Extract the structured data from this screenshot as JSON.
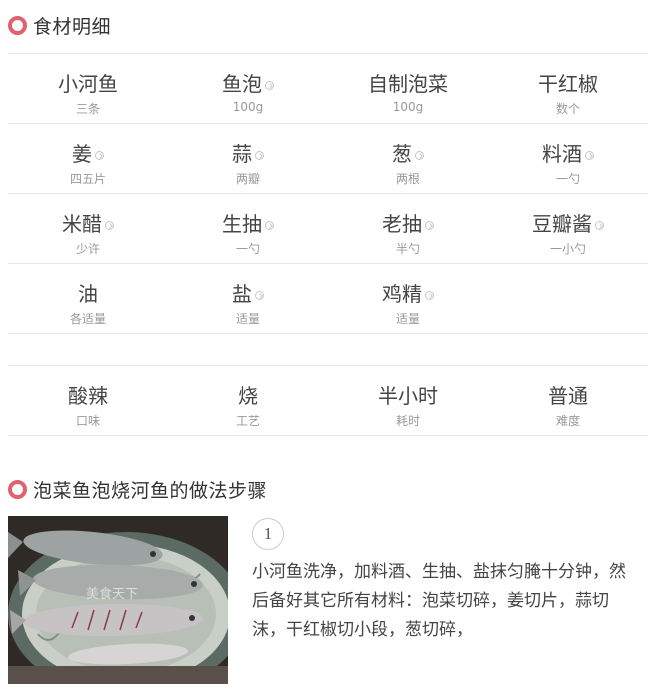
{
  "ingredients_section": {
    "title": "食材明细"
  },
  "ingredients": [
    [
      {
        "name": "小河鱼",
        "amount": "三条",
        "link": false
      },
      {
        "name": "鱼泡",
        "amount": "100g",
        "link": true
      },
      {
        "name": "自制泡菜",
        "amount": "100g",
        "link": false
      },
      {
        "name": "干红椒",
        "amount": "数个",
        "link": false
      }
    ],
    [
      {
        "name": "姜",
        "amount": "四五片",
        "link": true
      },
      {
        "name": "蒜",
        "amount": "两瓣",
        "link": true
      },
      {
        "name": "葱",
        "amount": "两根",
        "link": true
      },
      {
        "name": "料酒",
        "amount": "一勺",
        "link": true
      }
    ],
    [
      {
        "name": "米醋",
        "amount": "少许",
        "link": true
      },
      {
        "name": "生抽",
        "amount": "一勺",
        "link": true
      },
      {
        "name": "老抽",
        "amount": "半勺",
        "link": true
      },
      {
        "name": "豆瓣酱",
        "amount": "一小勺",
        "link": true
      }
    ],
    [
      {
        "name": "油",
        "amount": "各适量",
        "link": false
      },
      {
        "name": "盐",
        "amount": "适量",
        "link": true
      },
      {
        "name": "鸡精",
        "amount": "适量",
        "link": true
      }
    ]
  ],
  "meta": [
    {
      "value": "酸辣",
      "label": "口味"
    },
    {
      "value": "烧",
      "label": "工艺"
    },
    {
      "value": "半小时",
      "label": "耗时"
    },
    {
      "value": "普通",
      "label": "难度"
    }
  ],
  "steps_section": {
    "title": "泡菜鱼泡烧河鱼的做法步骤"
  },
  "steps": [
    {
      "number": "1",
      "text": "小河鱼洗净，加料酒、生抽、盐抹匀腌十分钟，然后备好其它所有材料：泡菜切碎，姜切片，蒜切沫，干红椒切小段，葱切碎，",
      "photo_watermark": "美食天下"
    }
  ],
  "colors": {
    "accent": "#e4606d",
    "divider": "#e6e6e6",
    "muted_text": "#999999"
  }
}
